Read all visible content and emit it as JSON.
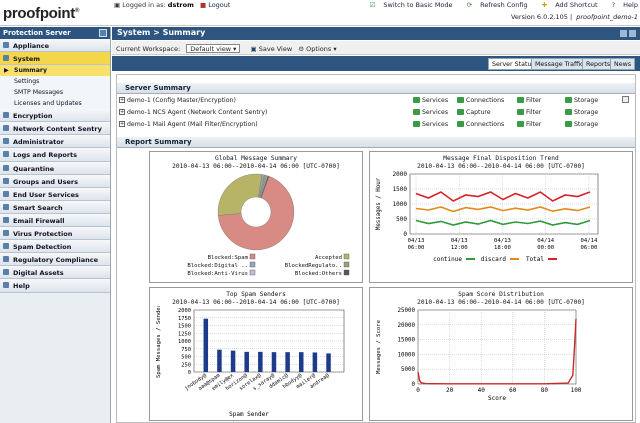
{
  "topbar": {
    "logo": "proofpoint",
    "logged_in_label": "Logged in as:",
    "user": "dstrom",
    "logout": "Logout",
    "links": [
      "Switch to Basic Mode",
      "Refresh Config",
      "Add Shortcut",
      "Help"
    ],
    "version": "Version 6.0.2.105",
    "product": "proofpoint_demo-1"
  },
  "sidebar": {
    "title": "Protection Server",
    "items": [
      {
        "label": "Appliance"
      },
      {
        "label": "System",
        "children": [
          "Summary",
          "Settings",
          "SMTP Messages",
          "Licenses and Updates"
        ]
      },
      {
        "label": "Encryption"
      },
      {
        "label": "Network Content Sentry"
      },
      {
        "label": "Administrator"
      },
      {
        "label": "Logs and Reports"
      },
      {
        "label": "Quarantine"
      },
      {
        "label": "Groups and Users"
      },
      {
        "label": "End User Services"
      },
      {
        "label": "Smart Search"
      },
      {
        "label": "Email Firewall"
      },
      {
        "label": "Virus Protection"
      },
      {
        "label": "Spam Detection"
      },
      {
        "label": "Regulatory Compliance"
      },
      {
        "label": "Digital Assets"
      },
      {
        "label": "Help"
      }
    ]
  },
  "breadcrumb": "System > Summary",
  "workspace": {
    "label": "Current Workspace:",
    "value": "Default view",
    "save": "Save View",
    "options": "Options"
  },
  "tabs": [
    "Server Status",
    "Message Traffic",
    "Reports",
    "News"
  ],
  "server_summary": {
    "title": "Server Summary",
    "rows": [
      {
        "name": "demo-1 (Config Master/Encryption)",
        "services": [
          "Services",
          "Connections",
          "Filter",
          "Storage"
        ]
      },
      {
        "name": "demo-1 NCS Agent (Network Content Sentry)",
        "services": [
          "Services",
          "Capture",
          "Filter",
          "Storage"
        ]
      },
      {
        "name": "demo-1 Mail Agent (Mail Filter/Encryption)",
        "services": [
          "Services",
          "Connections",
          "Filter",
          "Storage"
        ]
      }
    ]
  },
  "report_summary": {
    "title": "Report Summary"
  },
  "chart_data": [
    {
      "type": "pie",
      "title": "Global Message Summary",
      "subtitle": "2010-04-13 06:00--2010-04-14 06:00 [UTC-0700]",
      "categories": [
        "Blocked:Spam",
        "Accepted",
        "Blocked:Digital ..",
        "BlockedRegulato..",
        "Blocked:Anti-Virus",
        "Blocked:Others"
      ],
      "values": [
        68,
        29,
        1,
        1,
        0.5,
        0.5
      ],
      "colors": [
        "#d88a84",
        "#b7b367",
        "#8fa6c7",
        "#9aa070",
        "#c9b6d6",
        "#555555"
      ]
    },
    {
      "type": "line",
      "title": "Message Final Disposition Trend",
      "subtitle": "2010-04-13 06:00--2010-04-14 06:00 [UTC-0700]",
      "ylabel": "Messages / Hour",
      "ylim": [
        0,
        2000
      ],
      "yticks": [
        0,
        500,
        1000,
        1500,
        2000
      ],
      "xticks": [
        "04/13\n06:00",
        "04/13\n12:00",
        "04/13\n18:00",
        "04/14\n00:00",
        "04/14\n06:00"
      ],
      "series": [
        {
          "name": "continue",
          "color": "#2e9a3a",
          "values": [
            450,
            350,
            420,
            300,
            400,
            330,
            450,
            320,
            400,
            350,
            430,
            300,
            380,
            320,
            450
          ]
        },
        {
          "name": "discard",
          "color": "#e48a1a",
          "values": [
            850,
            800,
            900,
            750,
            880,
            820,
            900,
            780,
            860,
            800,
            900,
            760,
            840,
            780,
            900
          ]
        },
        {
          "name": "Total",
          "color": "#d8202a",
          "values": [
            1350,
            1200,
            1400,
            1100,
            1300,
            1250,
            1400,
            1150,
            1350,
            1200,
            1400,
            1100,
            1300,
            1250,
            1400
          ]
        }
      ]
    },
    {
      "type": "bar",
      "title": "Top Spam Senders",
      "subtitle": "2010-04-13 06:00--2010-04-14 06:00 [UTC-0700]",
      "xlabel": "Spam Sender",
      "ylabel": "Spam Messages / Sender",
      "ylim": [
        0,
        2000
      ],
      "yticks": [
        0,
        250,
        500,
        750,
        1000,
        1250,
        1500,
        1750,
        2000
      ],
      "categories": [
        "jnobody@",
        "aaa@spam",
        "emily@ex",
        "horizon@",
        "sorelax@",
        "s_saray@",
        "ddamic@",
        "hbodyy@",
        "mailer@",
        "andrea@"
      ],
      "values": [
        1720,
        720,
        690,
        650,
        650,
        640,
        640,
        640,
        630,
        600
      ]
    },
    {
      "type": "line",
      "title": "Spam Score Distribution",
      "subtitle": "2010-04-13 06:00--2010-04-14 06:00 [UTC-0700]",
      "xlabel": "Score",
      "ylabel": "Messages / Score",
      "ylim": [
        0,
        25000
      ],
      "yticks": [
        0,
        5000,
        10000,
        15000,
        20000,
        25000
      ],
      "xticks": [
        0,
        20,
        40,
        60,
        80,
        100
      ],
      "series": [
        {
          "name": "score",
          "color": "#c82a2a",
          "x": [
            0,
            1,
            2,
            5,
            10,
            20,
            40,
            60,
            80,
            95,
            98,
            99,
            100
          ],
          "values": [
            4000,
            1200,
            400,
            150,
            100,
            80,
            60,
            60,
            80,
            300,
            3000,
            12000,
            22000
          ]
        }
      ]
    }
  ]
}
